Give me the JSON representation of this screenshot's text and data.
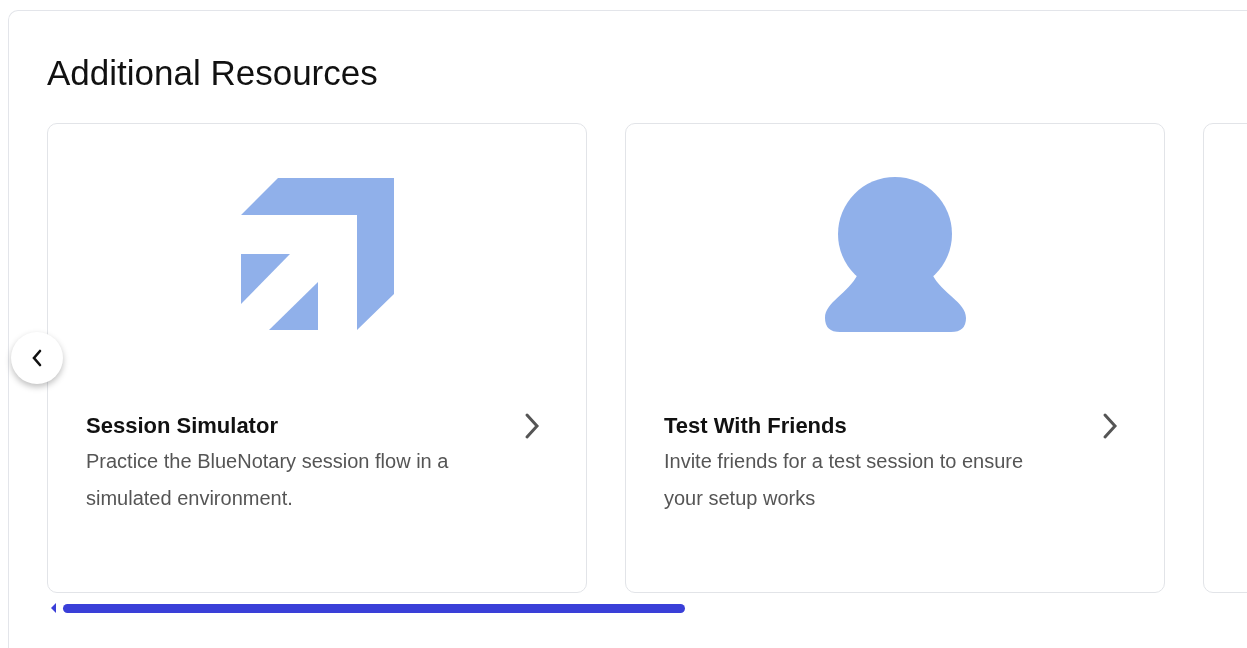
{
  "section": {
    "title": "Additional Resources"
  },
  "cards": [
    {
      "kind": "arrow",
      "title": "Session Simulator",
      "lines": [
        "Practice the BlueNotary session flow in a",
        "simulated environment."
      ]
    },
    {
      "kind": "person",
      "title": "Test With Friends",
      "lines": [
        "Invite friends for a test session to ensure",
        "your setup works"
      ]
    },
    {
      "kind": "partial"
    }
  ]
}
